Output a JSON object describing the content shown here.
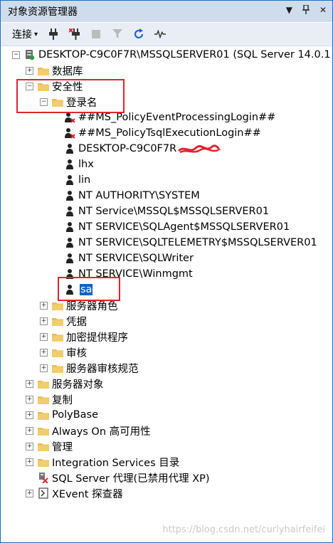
{
  "window": {
    "title": "对象资源管理器",
    "controls": [
      "▼",
      "📌",
      "✕"
    ]
  },
  "toolbar": {
    "connect_label": "连接",
    "connect_arrow": "▾",
    "icons": [
      "plug-icon",
      "disconnect-icon",
      "stop-icon",
      "filter-icon",
      "refresh-icon",
      "activity-icon"
    ]
  },
  "tree": {
    "root": "DESKTOP-C9C0F7R\\MSSQLSERVER01 (SQL Server 14.0.1",
    "databases": "数据库",
    "security": "安全性",
    "logins": "登录名",
    "login_items": [
      "##MS_PolicyEventProcessingLogin##",
      "##MS_PolicyTsqlExecutionLogin##",
      "DESKTOP-C9C0F7R",
      "lhx",
      "lin",
      "NT AUTHORITY\\SYSTEM",
      "NT Service\\MSSQL$MSSQLSERVER01",
      "NT SERVICE\\SQLAgent$MSSQLSERVER01",
      "NT SERVICE\\SQLTELEMETRY$MSSQLSERVER01",
      "NT SERVICE\\SQLWriter",
      "NT SERVICE\\Winmgmt",
      "sa"
    ],
    "security_children": [
      "服务器角色",
      "凭据",
      "加密提供程序",
      "审核",
      "服务器审核规范"
    ],
    "top_items": [
      "服务器对象",
      "复制",
      "PolyBase",
      "Always On 高可用性",
      "管理",
      "Integration Services 目录"
    ],
    "agent": "SQL Server 代理(已禁用代理 XP)",
    "xevent": "XEvent 探查器"
  },
  "watermark": "https://blog.csdn.net/curlyhairfeifei",
  "colors": {
    "accent": "#1e6fbf",
    "selection": "#0a63c8",
    "highlight_box": "#e0242e",
    "folder": "#e8bd5a"
  }
}
